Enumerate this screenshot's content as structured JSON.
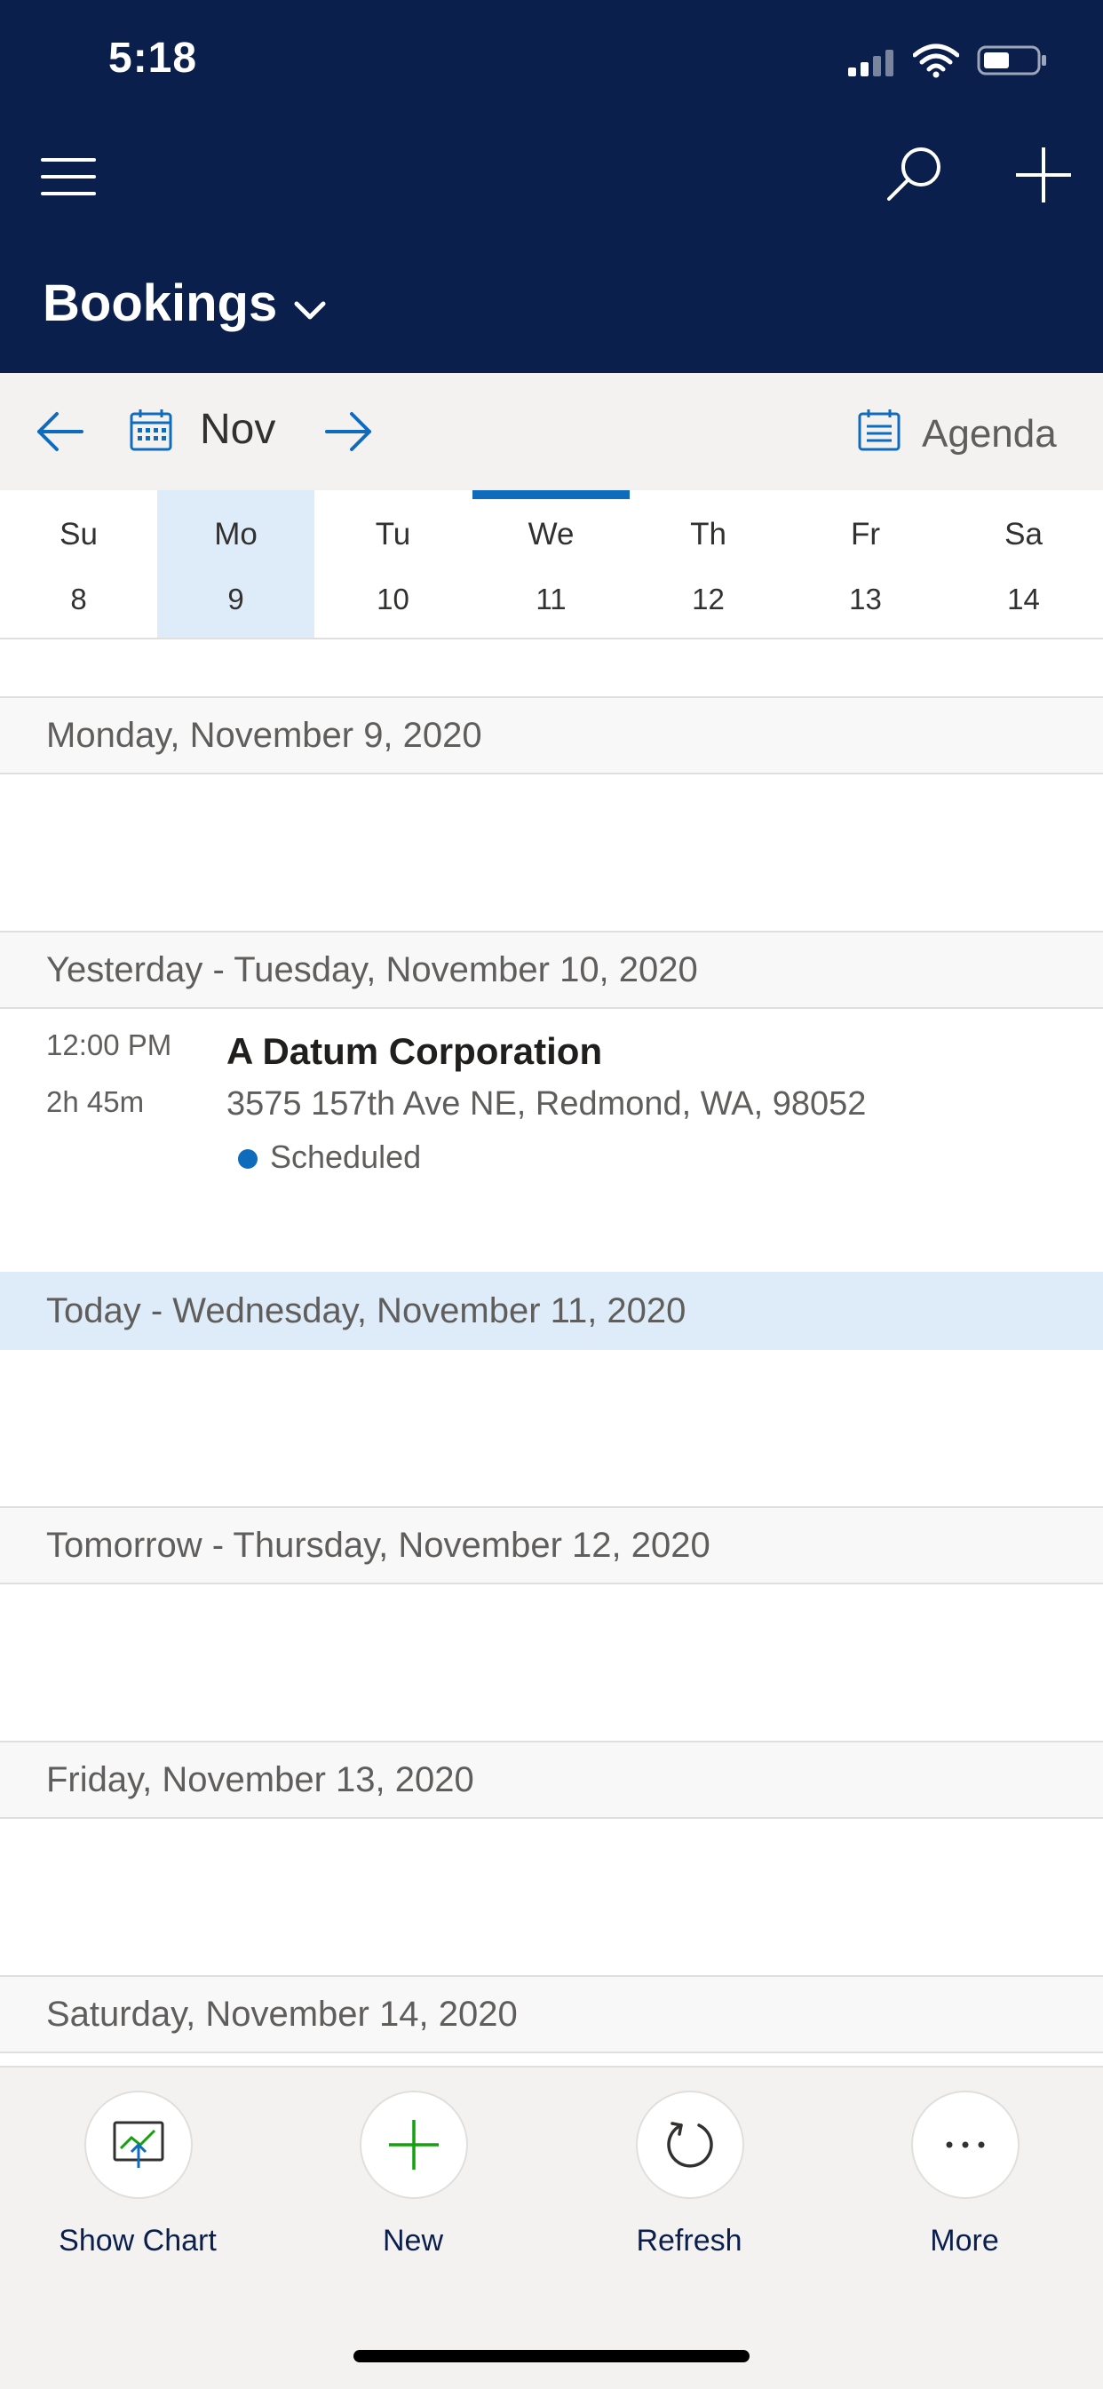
{
  "status_bar": {
    "time": "5:18"
  },
  "header": {
    "title": "Bookings",
    "icons": [
      "menu-icon",
      "search-icon",
      "add-icon",
      "chevron-down-icon"
    ]
  },
  "nav": {
    "month": "Nov",
    "view_label": "Agenda"
  },
  "week": {
    "days": [
      {
        "name": "Su",
        "date": "8"
      },
      {
        "name": "Mo",
        "date": "9"
      },
      {
        "name": "Tu",
        "date": "10"
      },
      {
        "name": "We",
        "date": "11"
      },
      {
        "name": "Th",
        "date": "12"
      },
      {
        "name": "Fr",
        "date": "13"
      },
      {
        "name": "Sa",
        "date": "14"
      }
    ],
    "selected_index": 1,
    "today_index": 3
  },
  "agenda": {
    "sections": [
      {
        "label": "Monday, November 9, 2020"
      },
      {
        "label": "Yesterday - Tuesday, November 10, 2020"
      },
      {
        "label": "Today - Wednesday, November 11, 2020"
      },
      {
        "label": "Tomorrow - Thursday, November 12, 2020"
      },
      {
        "label": "Friday, November 13, 2020"
      },
      {
        "label": "Saturday, November 14, 2020"
      }
    ],
    "event": {
      "time": "12:00 PM",
      "duration": "2h 45m",
      "title": "A Datum Corporation",
      "address": "3575 157th Ave NE, Redmond, WA, 98052",
      "status": "Scheduled",
      "status_color": "#0f6cbd"
    }
  },
  "commands": [
    {
      "label": "Show Chart",
      "icon": "chart-icon"
    },
    {
      "label": "New",
      "icon": "plus-icon"
    },
    {
      "label": "Refresh",
      "icon": "refresh-icon"
    },
    {
      "label": "More",
      "icon": "more-icon"
    }
  ],
  "colors": {
    "header_bg": "#0b1f4d",
    "accent": "#0f6cbd",
    "selected_day": "#deecf9",
    "new_green": "#13a10e"
  }
}
